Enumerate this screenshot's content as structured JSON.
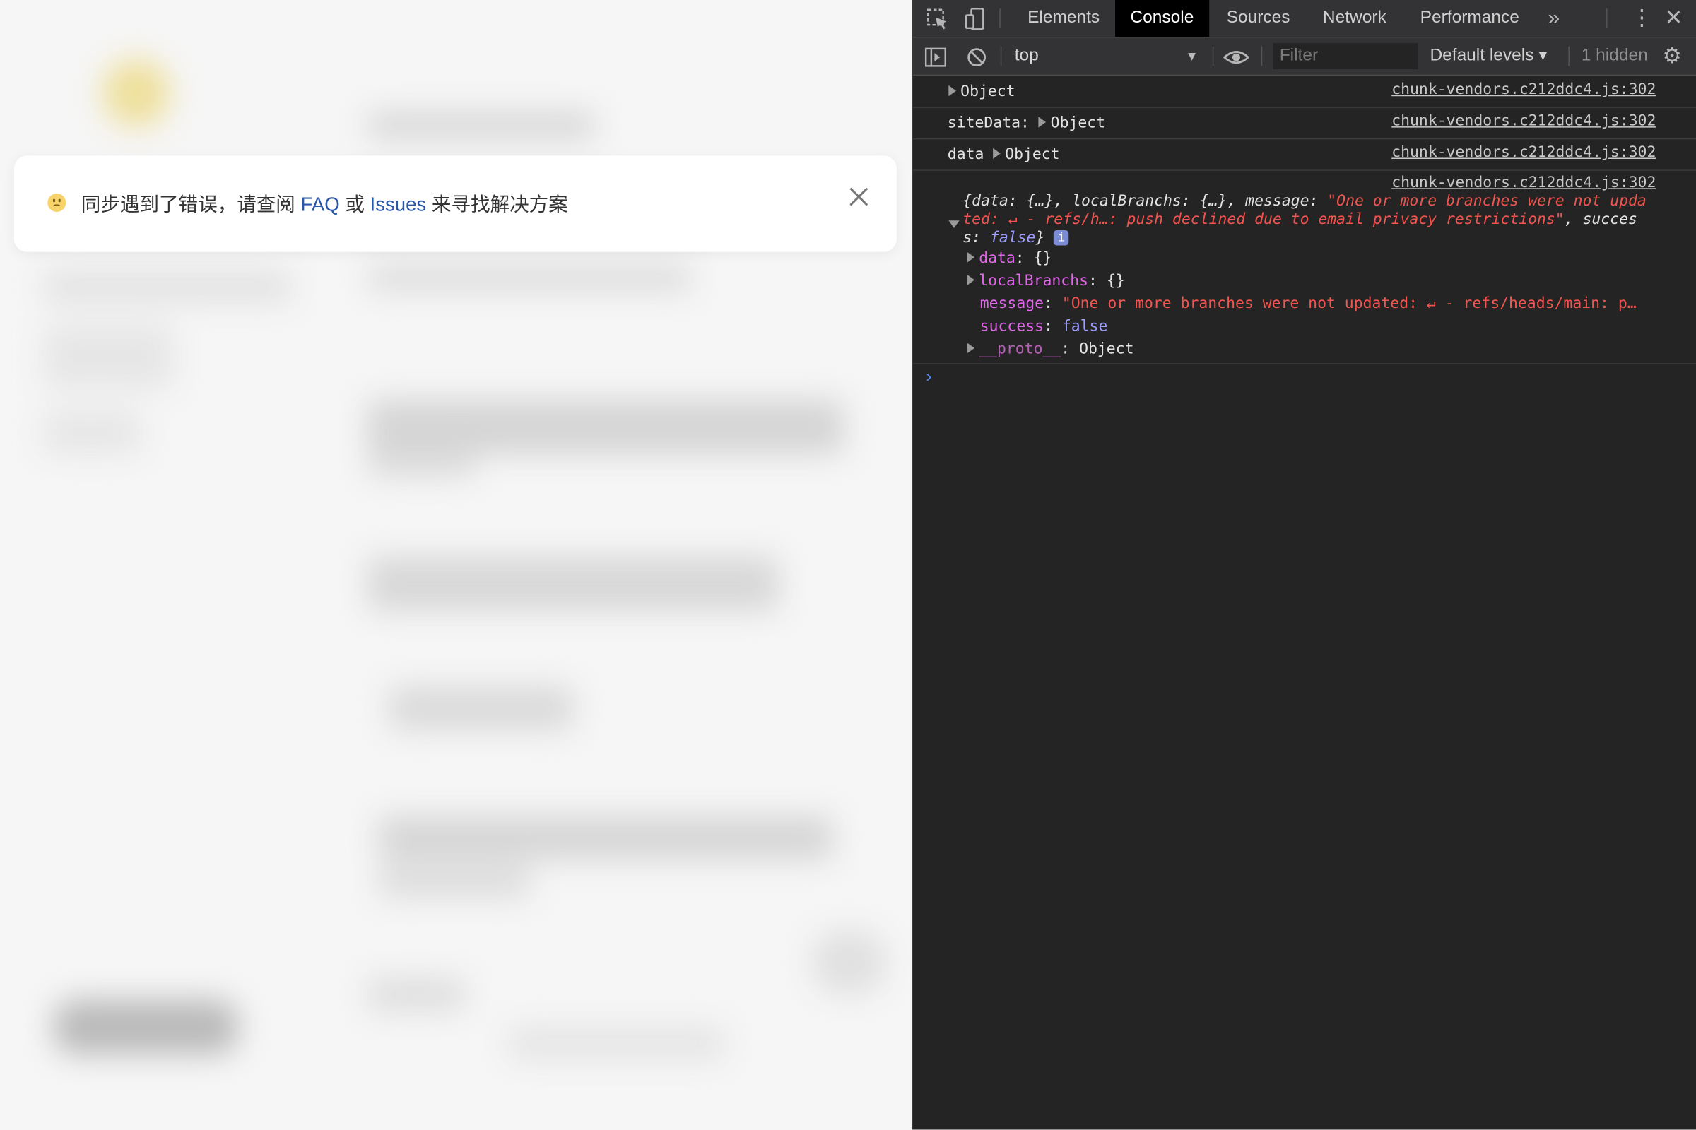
{
  "toast": {
    "text_before": "同步遇到了错误，请查阅",
    "link_faq": "FAQ",
    "text_or": "或",
    "link_issues": "Issues",
    "text_after": "来寻找解决方案"
  },
  "devtools": {
    "tabs": [
      "Elements",
      "Console",
      "Sources",
      "Network",
      "Performance"
    ],
    "active_tab": "Console",
    "more_tabs_icon": "»",
    "context": "top",
    "filter_placeholder": "Filter",
    "levels": "Default levels ▾",
    "hidden_count": "1 hidden"
  },
  "console": {
    "source": "chunk-vendors.c212ddc4.js:302",
    "rows": [
      {
        "label": "",
        "value": "Object"
      },
      {
        "label": "siteData:",
        "value": "Object"
      },
      {
        "label": "data",
        "value": "Object"
      }
    ],
    "expanded": {
      "preview_1": "{data: {…}, localBranchs: {…}, message: ",
      "preview_msg_a": "\"One or more branches were not upda",
      "preview_msg_b": "ted: ↵  - refs/h…: push declined due to email privacy restrictions\"",
      "preview_tail_b": ", succes",
      "preview_3a": "s: ",
      "preview_3b": "false",
      "preview_3c": "}",
      "info_icon": "i",
      "props": [
        {
          "key": "data",
          "value": "{}"
        },
        {
          "key": "localBranchs",
          "value": "{}"
        },
        {
          "key": "message",
          "value": "\"One or more branches were not updated: ↵  - refs/heads/main: p…"
        },
        {
          "key": "success",
          "value": "false"
        },
        {
          "key": "__proto__",
          "value": "Object"
        }
      ]
    },
    "prompt": "›"
  }
}
